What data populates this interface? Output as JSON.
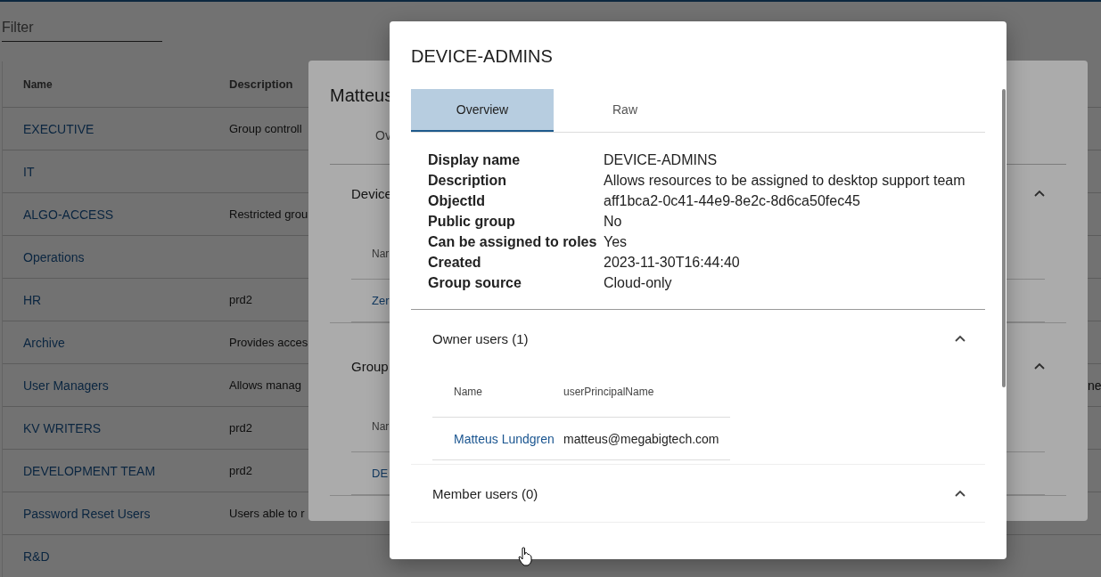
{
  "filter": {
    "placeholder": "Filter"
  },
  "table": {
    "columns": [
      "Name",
      "Description"
    ],
    "rows": [
      {
        "name": "EXECUTIVE",
        "description": "Group controll"
      },
      {
        "name": "IT"
      },
      {
        "name": "ALGO-ACCESS",
        "description": "Restricted grou"
      },
      {
        "name": "Operations"
      },
      {
        "name": "HR",
        "description": "prd2"
      },
      {
        "name": "Archive",
        "description": "Provides acces"
      },
      {
        "name": "User Managers",
        "description": "Allows manag",
        "column_5": "ne"
      },
      {
        "name": "KV WRITERS",
        "description": "prd2"
      },
      {
        "name": "DEVELOPMENT TEAM",
        "description": "prd2"
      },
      {
        "name": "Password Reset Users",
        "description": "Users able to r"
      },
      {
        "name": "R&D"
      }
    ]
  },
  "back_dialog": {
    "title": "Matteus",
    "tab": "Ov",
    "sections": [
      {
        "title": "Device",
        "expanded": true,
        "column": "Nar",
        "row": "Zer"
      },
      {
        "title": "Group",
        "expanded": true,
        "column": "Nar",
        "row": "DE"
      }
    ]
  },
  "dialog": {
    "title": "DEVICE-ADMINS",
    "tabs": [
      {
        "label": "Overview",
        "selected": true
      },
      {
        "label": "Raw",
        "selected": false
      }
    ],
    "properties": [
      {
        "label": "Display name",
        "value": "DEVICE-ADMINS"
      },
      {
        "label": "Description",
        "value": "Allows resources to be assigned to desktop support team"
      },
      {
        "label": "ObjectId",
        "value": "aff1bca2-0c41-44e9-8e2c-8d6ca50fec45"
      },
      {
        "label": "Public group",
        "value": "No"
      },
      {
        "label": "Can be assigned to roles",
        "value": "Yes"
      },
      {
        "label": "Created",
        "value": "2023-11-30T16:44:40"
      },
      {
        "label": "Group source",
        "value": "Cloud-only"
      }
    ],
    "sections": [
      {
        "title": "Owner users (1)",
        "expanded": true,
        "columns": [
          "Name",
          "userPrincipalName"
        ],
        "rows": [
          {
            "name": "Matteus Lundgren",
            "upn": "matteus@megabigtech.com"
          }
        ]
      },
      {
        "title": "Member users (0)",
        "expanded": true
      }
    ]
  }
}
